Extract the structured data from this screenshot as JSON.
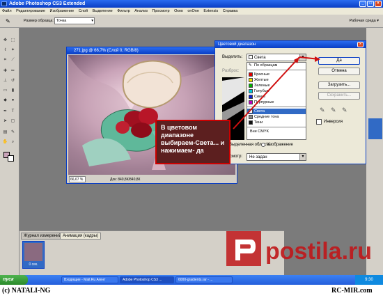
{
  "window": {
    "title": "Adobe Photoshop CS3 Extended"
  },
  "menu": [
    "Файл",
    "Редактирование",
    "Изображение",
    "Слой",
    "Выделение",
    "Фильтр",
    "Анализ",
    "Просмотр",
    "Окно",
    "onOne",
    "Extensis",
    "Справка"
  ],
  "options": {
    "sample_label": "Размер образца:",
    "sample_value": "Точка",
    "workspace_label": "Рабочая среда"
  },
  "document": {
    "title": "271.jpg @ 66,7% (Слой 0, RGB/8)",
    "zoom": "66,67 %",
    "doc_info": "Док: 840,8К/840,8К"
  },
  "dialog": {
    "title": "Цветовой диапазон",
    "select_label": "Выделить:",
    "select_value": "Света",
    "fuzziness_label": "Разброс:",
    "list_items": [
      {
        "label": "По образцам",
        "color": "#ffffff",
        "icon": "eyedropper-icon"
      },
      {
        "label": "Красные",
        "color": "#e00000"
      },
      {
        "label": "Желтые",
        "color": "#f0e000"
      },
      {
        "label": "Зеленые",
        "color": "#00b000"
      },
      {
        "label": "Голубые",
        "color": "#00c8d8"
      },
      {
        "label": "Синие",
        "color": "#1020d0"
      },
      {
        "label": "Пурпурные",
        "color": "#c000c0"
      }
    ],
    "tone_items": [
      {
        "label": "Света",
        "color": "#ffffff",
        "selected": true
      },
      {
        "label": "Средние тона",
        "color": "#888888"
      },
      {
        "label": "Тени",
        "color": "#111111"
      }
    ],
    "gamut_item": "Вне CMYK",
    "selection_radio": "Выделенная область",
    "image_radio": "Изображение",
    "preview_label": "Просмотр:",
    "preview_value": "Не задан",
    "buttons": {
      "ok": "Да",
      "cancel": "Отмена",
      "load": "Загрузить...",
      "save": "Сохранить..."
    },
    "invert_label": "Инверсия"
  },
  "callout": {
    "text": "В цветовом диапазоне выбираем-Света... и нажимаем- да"
  },
  "panels": {
    "tab_measure": "Журнал измерений",
    "tab_anim": "Анимация (кадры)",
    "frame_time": "0 сек."
  },
  "taskbar": {
    "start": "пуск",
    "tasks": [
      "Входящие - Mail.Ru Агент",
      "Adobe Photoshop CS3 ...",
      "6000-gradients.rar - ..."
    ],
    "clock": "9:30"
  },
  "footer": {
    "left": "(c) NATALI-NG",
    "right": "RC-MIR.com"
  },
  "watermark": {
    "text": "postila.ru"
  },
  "colors": {
    "xp_blue": "#0a3ec4",
    "callout_border": "#cc0000",
    "watermark_red": "#c0171a"
  }
}
